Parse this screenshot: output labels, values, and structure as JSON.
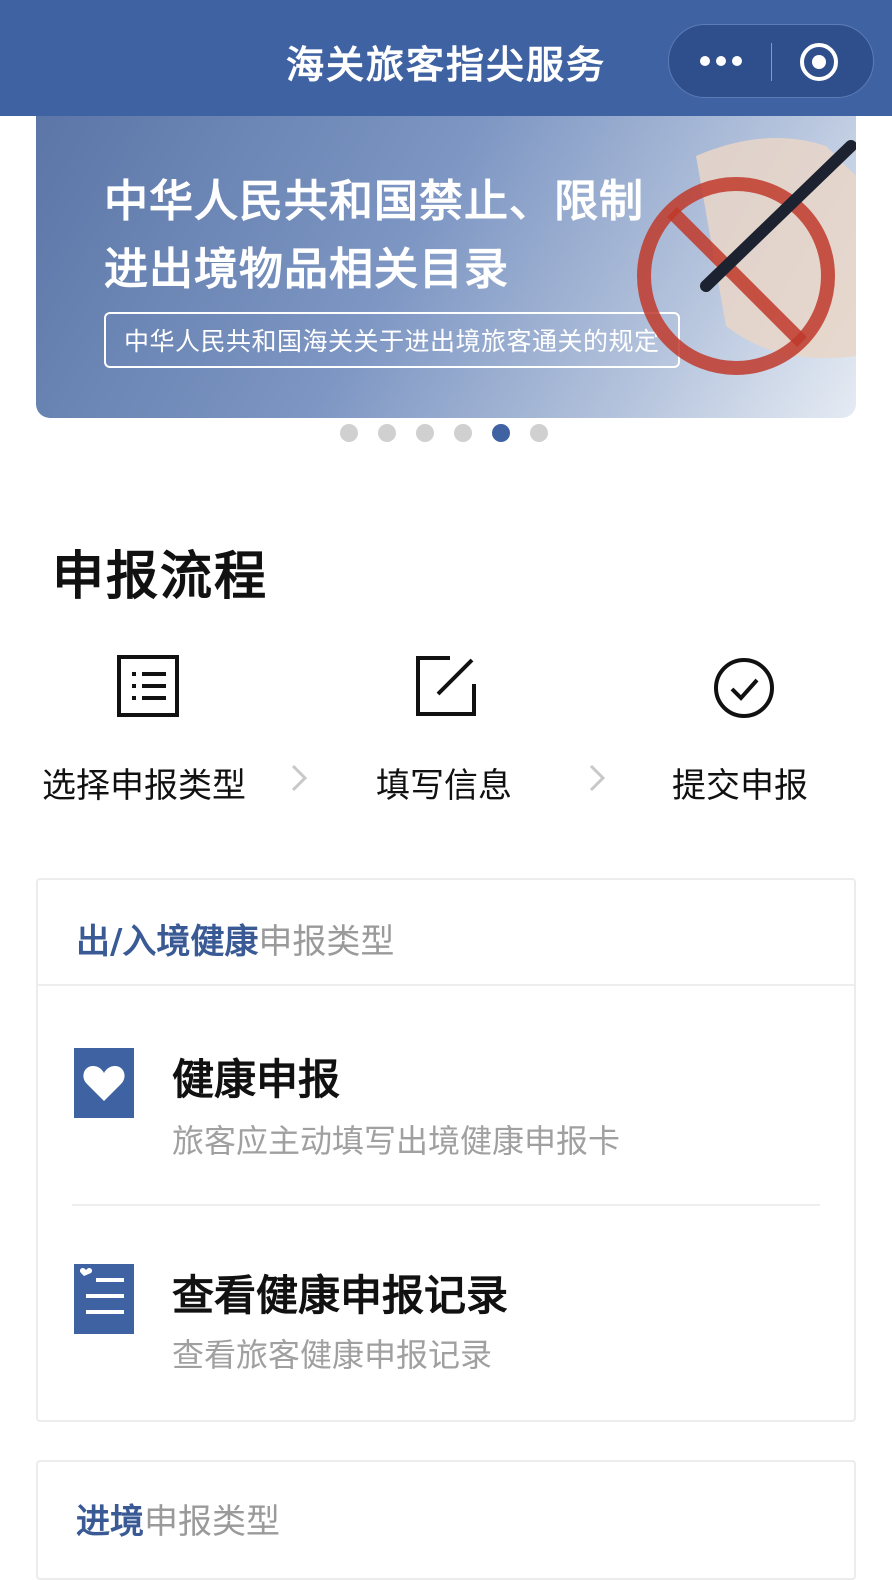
{
  "nav": {
    "title": "海关旅客指尖服务"
  },
  "banner": {
    "title_line1": "中华人民共和国禁止、限制",
    "title_line2": "进出境物品相关目录",
    "subtitle": "中华人民共和国海关关于进出境旅客通关的规定"
  },
  "carousel": {
    "count": 6,
    "active_index": 4
  },
  "process": {
    "title": "申报流程",
    "steps": [
      {
        "label": "选择申报类型",
        "icon": "list-icon"
      },
      {
        "label": "填写信息",
        "icon": "edit-icon"
      },
      {
        "label": "提交申报",
        "icon": "check-circle-icon"
      }
    ]
  },
  "health_section": {
    "header_strong": "出/入境健康",
    "header_light": "申报类型",
    "items": [
      {
        "title": "健康申报",
        "desc": "旅客应主动填写出境健康申报卡",
        "icon": "heart-icon"
      },
      {
        "title": "查看健康申报记录",
        "desc": "查看旅客健康申报记录",
        "icon": "record-list-icon"
      }
    ]
  },
  "entry_section": {
    "header_strong": "进境",
    "header_light": "申报类型"
  },
  "colors": {
    "brand": "#3f62a3",
    "accent_text": "#3a5a95"
  }
}
